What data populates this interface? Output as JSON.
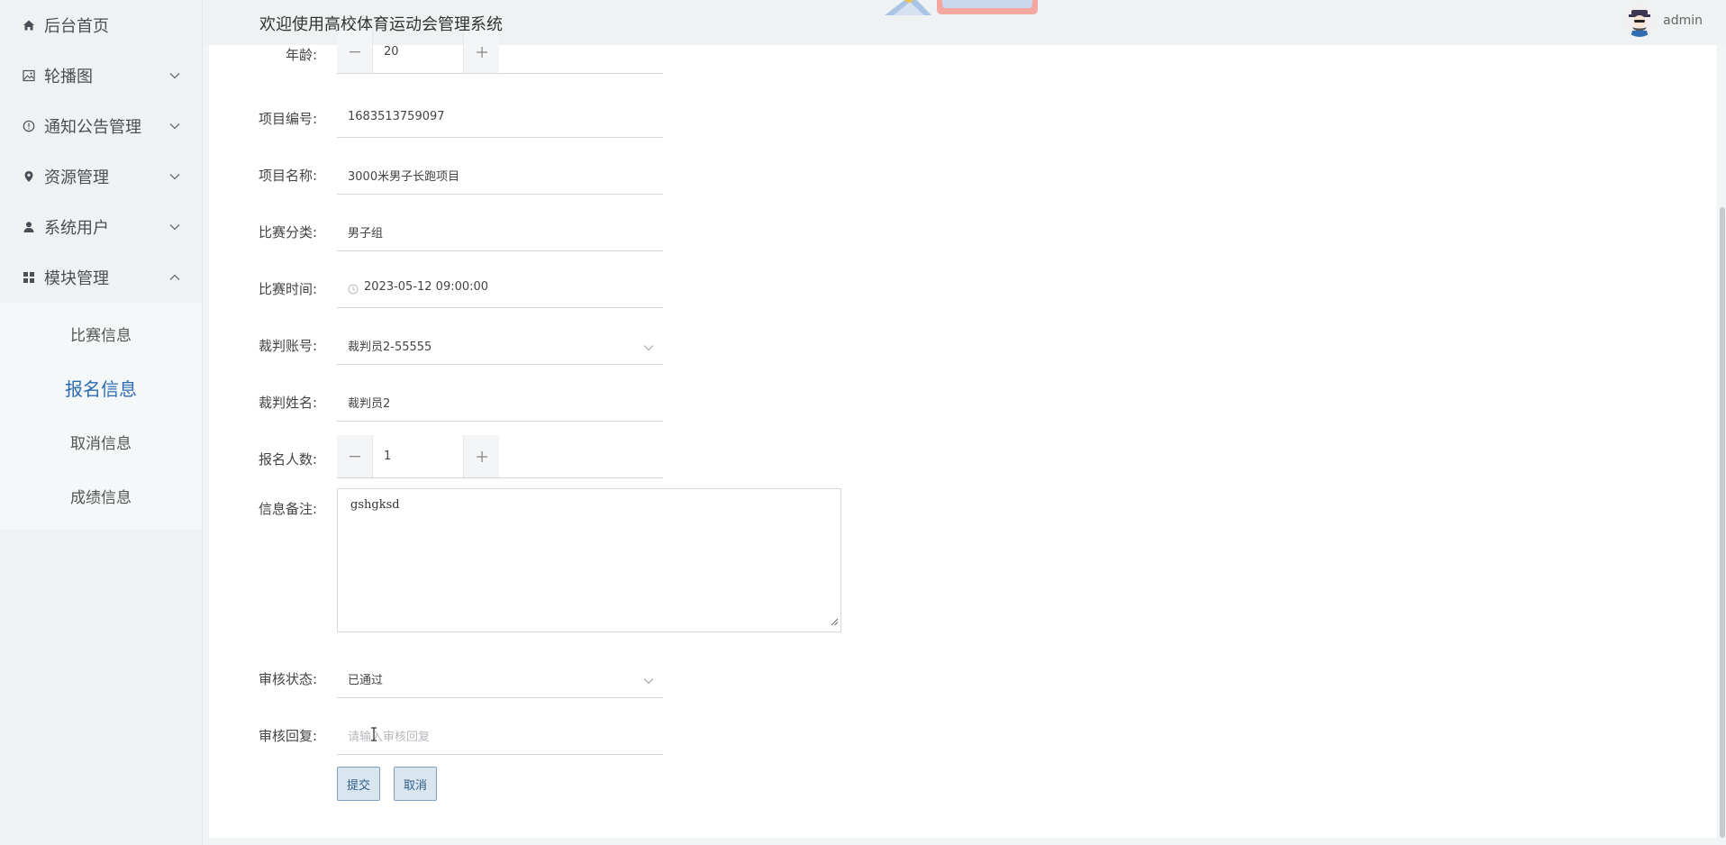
{
  "sidebar": {
    "items": [
      {
        "label": "后台首页",
        "icon": "home-icon"
      },
      {
        "label": "轮播图",
        "icon": "image-icon"
      },
      {
        "label": "通知公告管理",
        "icon": "info-circle-icon"
      },
      {
        "label": "资源管理",
        "icon": "location-icon"
      },
      {
        "label": "系统用户",
        "icon": "user-icon"
      },
      {
        "label": "模块管理",
        "icon": "grid-icon"
      }
    ],
    "subitems": [
      "比赛信息",
      "报名信息",
      "取消信息",
      "成绩信息"
    ]
  },
  "header": {
    "title": "欢迎使用高校体育运动会管理系统",
    "username": "admin"
  },
  "form": {
    "age": {
      "label": "年龄:",
      "value": "20"
    },
    "project_no": {
      "label": "项目编号:",
      "value": "1683513759097"
    },
    "project_name": {
      "label": "项目名称:",
      "value": "3000米男子长跑项目"
    },
    "category": {
      "label": "比赛分类:",
      "value": "男子组"
    },
    "match_time": {
      "label": "比赛时间:",
      "value": "2023-05-12 09:00:00"
    },
    "referee_account": {
      "label": "裁判账号:",
      "value": "裁判员2-55555"
    },
    "referee_name": {
      "label": "裁判姓名:",
      "value": "裁判员2"
    },
    "signup_count": {
      "label": "报名人数:",
      "value": "1"
    },
    "remark": {
      "label": "信息备注:",
      "value": "gshgksd"
    },
    "review_status": {
      "label": "审核状态:",
      "value": "已通过"
    },
    "review_reply": {
      "label": "审核回复:",
      "placeholder": "请输入审核回复"
    },
    "submit_label": "提交",
    "cancel_label": "取消"
  },
  "colors": {
    "accent": "#2f6bb3",
    "sidebar_bg": "#eef2f3"
  }
}
